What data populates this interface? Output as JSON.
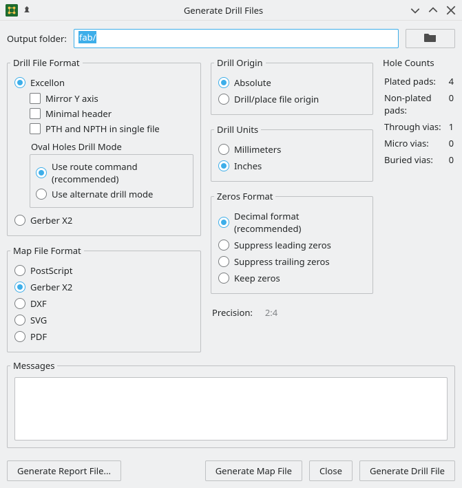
{
  "window": {
    "title": "Generate Drill Files"
  },
  "output": {
    "label": "Output folder:",
    "value": "fab/"
  },
  "drillFileFormat": {
    "legend": "Drill File Format",
    "excellon": "Excellon",
    "mirrorY": "Mirror Y axis",
    "minimalHeader": "Minimal header",
    "pthNpth": "PTH and NPTH in single file",
    "ovalTitle": "Oval Holes Drill Mode",
    "ovalRoute": "Use route command (recommended)",
    "ovalAlt": "Use alternate drill mode",
    "gerberX2": "Gerber X2"
  },
  "mapFileFormat": {
    "legend": "Map File Format",
    "postscript": "PostScript",
    "gerberX2": "Gerber X2",
    "dxf": "DXF",
    "svg": "SVG",
    "pdf": "PDF"
  },
  "drillOrigin": {
    "legend": "Drill Origin",
    "absolute": "Absolute",
    "place": "Drill/place file origin"
  },
  "drillUnits": {
    "legend": "Drill Units",
    "mm": "Millimeters",
    "in": "Inches"
  },
  "zerosFormat": {
    "legend": "Zeros Format",
    "decimal": "Decimal format (recommended)",
    "supLead": "Suppress leading zeros",
    "supTrail": "Suppress trailing zeros",
    "keep": "Keep zeros"
  },
  "precision": {
    "label": "Precision:",
    "value": "2:4"
  },
  "holeCounts": {
    "legend": "Hole Counts",
    "plated": {
      "label": "Plated pads:",
      "value": "4"
    },
    "nonplated": {
      "label": "Non-plated pads:",
      "value": "0"
    },
    "through": {
      "label": "Through vias:",
      "value": "1"
    },
    "micro": {
      "label": "Micro vias:",
      "value": "0"
    },
    "buried": {
      "label": "Buried vias:",
      "value": "0"
    }
  },
  "messages": {
    "legend": "Messages"
  },
  "buttons": {
    "report": "Generate Report File...",
    "map": "Generate Map File",
    "close": "Close",
    "drill": "Generate Drill File"
  }
}
